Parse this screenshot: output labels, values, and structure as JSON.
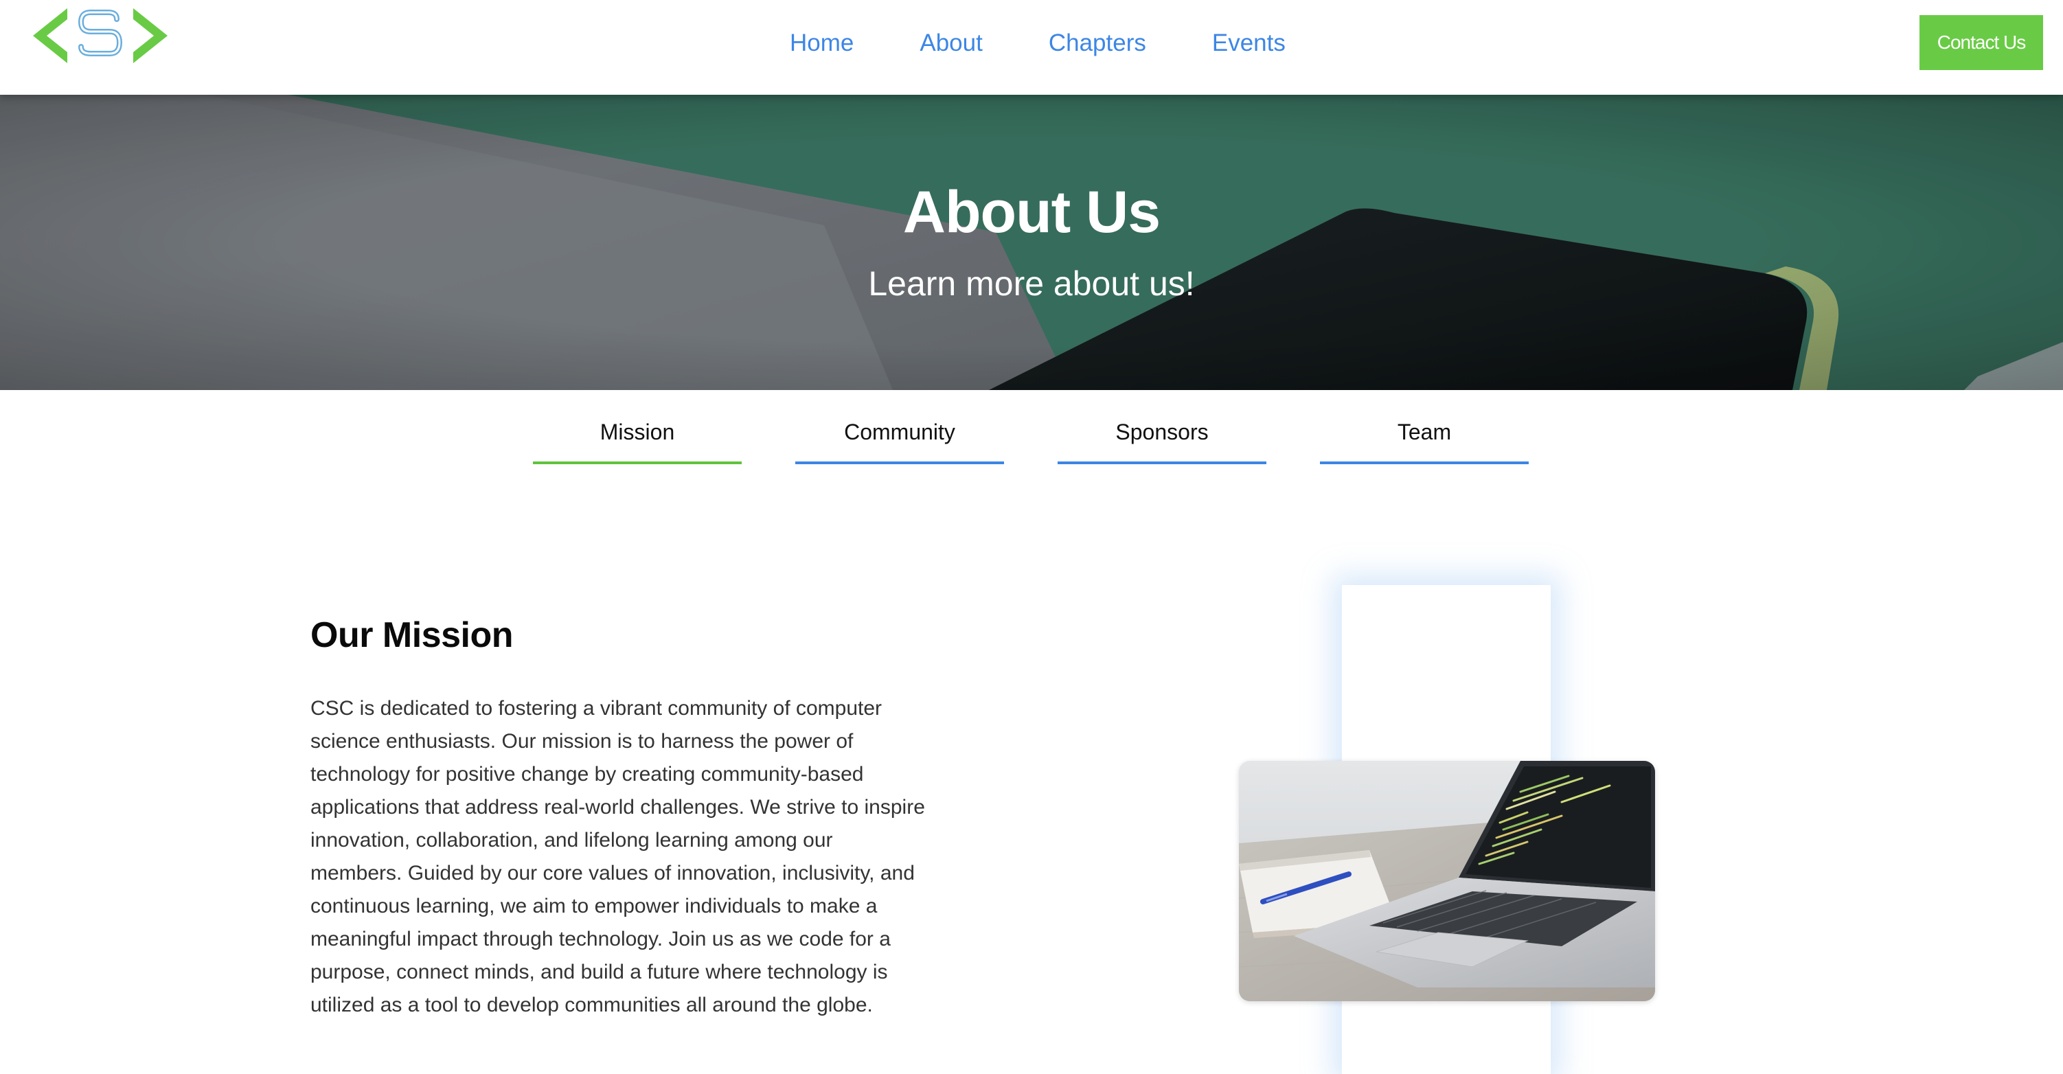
{
  "brand": {
    "logo_text": "S",
    "colors": {
      "logo_green": "#69cb45",
      "logo_blue": "#6aaedc",
      "link_blue": "#3d86e5",
      "accent_green": "#69cb45"
    }
  },
  "nav": {
    "links": [
      {
        "label": "Home"
      },
      {
        "label": "About"
      },
      {
        "label": "Chapters"
      },
      {
        "label": "Events"
      }
    ],
    "contact_label": "Contact Us"
  },
  "hero": {
    "title": "About Us",
    "subtitle": "Learn more about us!"
  },
  "tabs": [
    {
      "label": "Mission",
      "active": true
    },
    {
      "label": "Community",
      "active": false
    },
    {
      "label": "Sponsors",
      "active": false
    },
    {
      "label": "Team",
      "active": false
    }
  ],
  "mission": {
    "heading": "Our Mission",
    "body": "CSC is dedicated to fostering a vibrant community of computer science enthusiasts. Our mission is to harness the power of technology for positive change by creating community-based applications that address real-world challenges. We strive to inspire innovation, collaboration, and lifelong learning among our members. Guided by our core values of innovation, inclusivity, and continuous learning, we aim to empower individuals to make a meaningful impact through technology. Join us as we code for a purpose, connect minds, and build a future where technology is utilized as a tool to develop communities all around the globe."
  }
}
